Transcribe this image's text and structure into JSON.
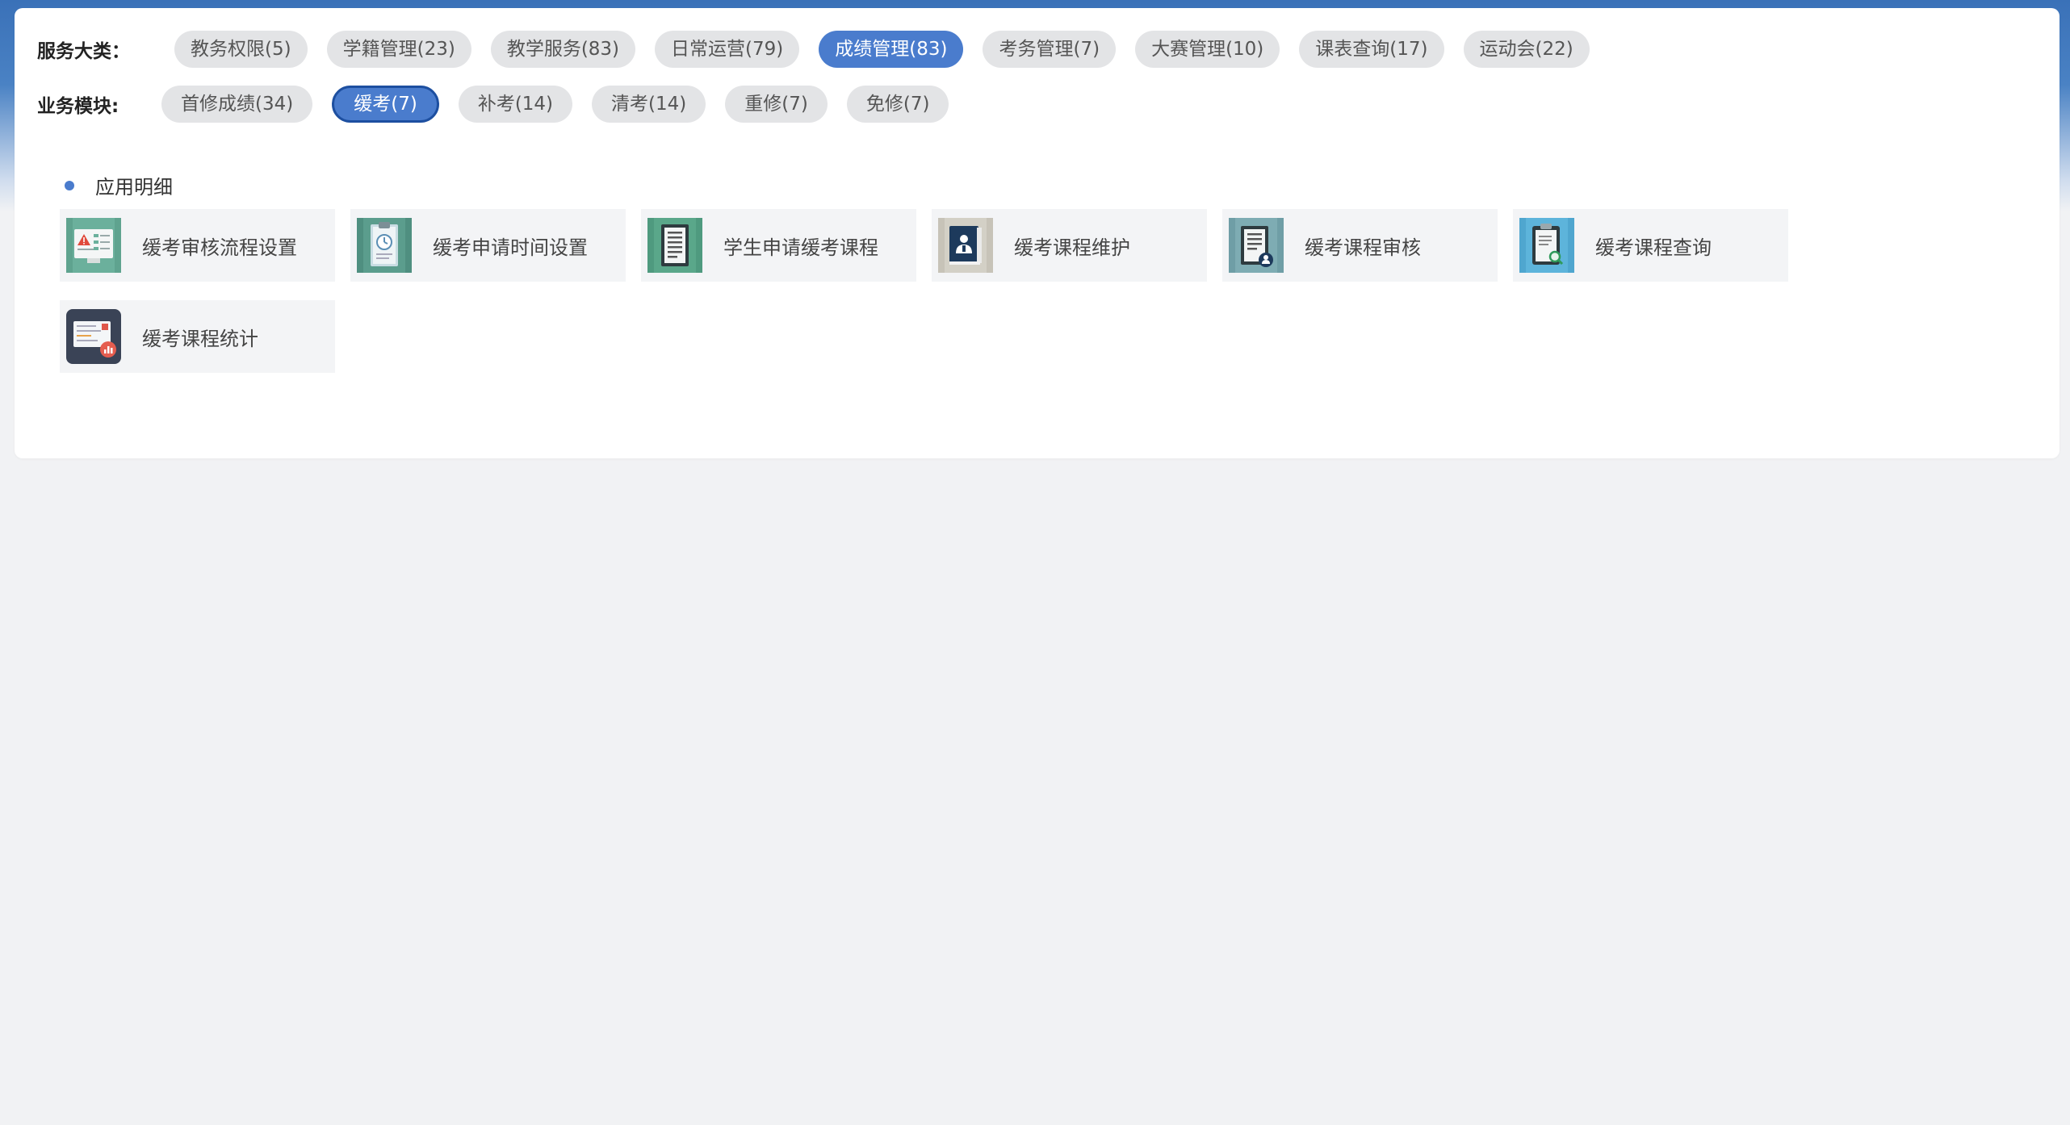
{
  "service_category": {
    "label": "服务大类：",
    "items": [
      {
        "label": "教务权限(5)"
      },
      {
        "label": "学籍管理(23)"
      },
      {
        "label": "教学服务(83)"
      },
      {
        "label": "日常运营(79)"
      },
      {
        "label": "成绩管理(83)",
        "selected": true
      },
      {
        "label": "考务管理(7)"
      },
      {
        "label": "大赛管理(10)"
      },
      {
        "label": "课表查询(17)"
      },
      {
        "label": "运动会(22)"
      }
    ]
  },
  "business_module": {
    "label": "业务模块:",
    "items": [
      {
        "label": "首修成绩(34)"
      },
      {
        "label": "缓考(7)",
        "selected": true
      },
      {
        "label": "补考(14)"
      },
      {
        "label": "清考(14)"
      },
      {
        "label": "重修(7)"
      },
      {
        "label": "免修(7)"
      }
    ]
  },
  "app_section": {
    "title": "应用明细",
    "apps": [
      {
        "label": "缓考审核流程设置",
        "icon": "audit-flow-settings-icon"
      },
      {
        "label": "缓考申请时间设置",
        "icon": "clipboard-clock-icon"
      },
      {
        "label": "学生申请缓考课程",
        "icon": "document-list-icon"
      },
      {
        "label": "缓考课程维护",
        "icon": "book-person-icon"
      },
      {
        "label": "缓考课程审核",
        "icon": "document-user-icon"
      },
      {
        "label": "缓考课程查询",
        "icon": "clipboard-search-icon"
      },
      {
        "label": "缓考课程统计",
        "icon": "stats-chart-icon"
      }
    ]
  },
  "colors": {
    "accent": "#4a7ccd",
    "accent_border": "#1d4fa0",
    "header_blue": "#3a71b8",
    "chip_bg": "#e3e4e6",
    "tile_bg": "#f3f4f6",
    "page_bg": "#f1f2f4"
  }
}
